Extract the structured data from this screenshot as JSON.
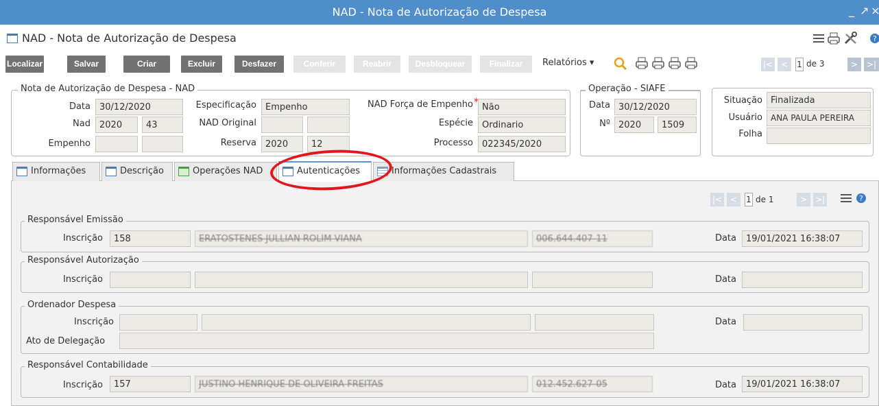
{
  "window": {
    "title": "NAD - Nota de Autorização de Despesa",
    "controls": [
      "_",
      "↗",
      "×"
    ]
  },
  "header": {
    "title": "NAD - Nota de Autorização de Despesa"
  },
  "toolbar": {
    "buttons": [
      "Localizar",
      "Salvar",
      "Criar",
      "Excluir",
      "Desfazer",
      "Conferir",
      "Reabrir",
      "Desbloquear",
      "Finalizar"
    ],
    "reports_label": "Relatórios ▾",
    "pager": {
      "current": "1",
      "of_label": "de 3"
    }
  },
  "nad": {
    "legend": "Nota de Autorização de Despesa - NAD",
    "data_label": "Data",
    "data": "30/12/2020",
    "nad_label": "Nad",
    "nad_year": "2020",
    "nad_num": "43",
    "empenho_label": "Empenho",
    "empenho_a": "",
    "empenho_b": "",
    "especificacao_label": "Especificação",
    "especificacao": "Empenho",
    "nad_original_label": "NAD Original",
    "nad_original_a": "",
    "nad_original_b": "",
    "reserva_label": "Reserva",
    "reserva_year": "2020",
    "reserva_num": "12",
    "forca_label": "NAD Força de Empenho",
    "required_mark": "*",
    "forca": "Não",
    "especie_label": "Espécie",
    "especie": "Ordinario",
    "processo_label": "Processo",
    "processo": "022345/2020"
  },
  "siafe": {
    "legend": "Operação - SIAFE",
    "data_label": "Data",
    "data": "30/12/2020",
    "num_label": "Nº",
    "num_year": "2020",
    "num": "1509"
  },
  "situacao": {
    "situacao_label": "Situação",
    "situacao": "Finalizada",
    "usuario_label": "Usuário",
    "usuario": "ANA PAULA PEREIRA",
    "folha_label": "Folha",
    "folha": ""
  },
  "tabs": [
    "Informações",
    "Descrição",
    "Operações NAD",
    "Autenticações",
    "Informações Cadastrais"
  ],
  "panel": {
    "pager": {
      "current": "1",
      "of_label": "de 1"
    },
    "emissao": {
      "legend": "Responsável Emissão",
      "inscricao_label": "Inscrição",
      "inscricao": "158",
      "nome": "ERATOSTENES JULLIAN ROLIM VIANA",
      "cpf": "006.644.407-11",
      "data_label": "Data",
      "data": "19/01/2021 16:38:07"
    },
    "autorizacao": {
      "legend": "Responsável Autorização",
      "inscricao_label": "Inscrição",
      "data_label": "Data"
    },
    "ordenador": {
      "legend": "Ordenador Despesa",
      "inscricao_label": "Inscrição",
      "data_label": "Data",
      "ato_label": "Ato de Delegação"
    },
    "contabilidade": {
      "legend": "Responsável Contabilidade",
      "inscricao_label": "Inscrição",
      "inscricao": "157",
      "nome": "JUSTINO HENRIQUE DE OLIVEIRA FREITAS",
      "cpf": "012.452.627-05",
      "data_label": "Data",
      "data": "19/01/2021 16:38:07"
    }
  },
  "colors": {
    "titlebar": "#4f8ecb",
    "button": "#727272",
    "highlight": "#e3161c"
  }
}
